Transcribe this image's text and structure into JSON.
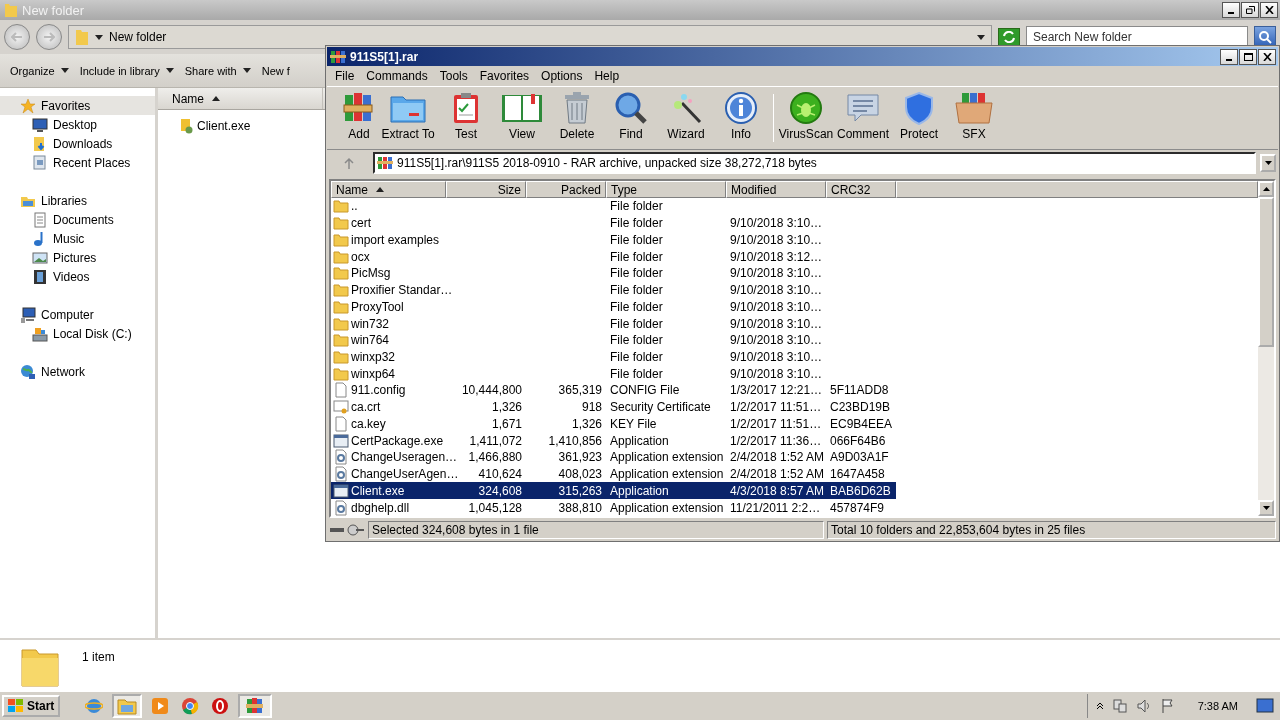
{
  "explorer": {
    "title": "New folder",
    "breadcrumb": "New folder",
    "search": {
      "placeholder": "Search New folder"
    },
    "commands": [
      {
        "label": "Organize",
        "menu": true
      },
      {
        "label": "Include in library",
        "menu": true
      },
      {
        "label": "Share with",
        "menu": true
      },
      {
        "label": "New f",
        "menu": false
      }
    ],
    "nav": [
      {
        "label": "Favorites",
        "selected": true,
        "children": [
          {
            "label": "Desktop",
            "selected": false
          },
          {
            "label": "Downloads",
            "selected": false
          },
          {
            "label": "Recent Places",
            "selected": false
          }
        ]
      },
      {
        "label": "Libraries",
        "selected": false,
        "children": [
          {
            "label": "Documents",
            "selected": false
          },
          {
            "label": "Music",
            "selected": false
          },
          {
            "label": "Pictures",
            "selected": false
          },
          {
            "label": "Videos",
            "selected": false
          }
        ]
      },
      {
        "label": "Computer",
        "selected": false,
        "children": [
          {
            "label": "Local Disk (C:)",
            "selected": false
          }
        ]
      },
      {
        "label": "Network",
        "selected": false
      }
    ],
    "columns": [
      {
        "label": "Name",
        "sorted": true
      }
    ],
    "files": [
      {
        "name": "Client.exe"
      }
    ],
    "details": {
      "count": "1 item"
    }
  },
  "archiver": {
    "title": "911S5[1].rar",
    "menu": [
      "File",
      "Commands",
      "Tools",
      "Favorites",
      "Options",
      "Help"
    ],
    "toolbar": [
      {
        "buttons": [
          {
            "label": "Add"
          },
          {
            "label": "Extract To"
          },
          {
            "label": "Test"
          },
          {
            "label": "View"
          },
          {
            "label": "Delete"
          },
          {
            "label": "Find"
          },
          {
            "label": "Wizard"
          },
          {
            "label": "Info"
          }
        ]
      },
      {
        "buttons": [
          {
            "label": "VirusScan"
          },
          {
            "label": "Comment"
          },
          {
            "label": "Protect"
          },
          {
            "label": "SFX"
          }
        ]
      }
    ],
    "path": "911S5[1].rar\\911S5 2018-0910 - RAR archive, unpacked size 38,272,718 bytes",
    "columns": [
      {
        "label": "Name",
        "sorted": true
      },
      {
        "label": "Size",
        "sorted": false
      },
      {
        "label": "Packed",
        "sorted": false
      },
      {
        "label": "Type",
        "sorted": false
      },
      {
        "label": "Modified",
        "sorted": false
      },
      {
        "label": "CRC32",
        "sorted": false
      }
    ],
    "rows": [
      {
        "kind": "folder",
        "name": "..",
        "size": "",
        "packed": "",
        "type": "File folder",
        "modified": "",
        "crc": "",
        "selected": false
      },
      {
        "kind": "folder",
        "name": "cert",
        "type": "File folder",
        "modified": "9/10/2018 3:10…",
        "selected": false
      },
      {
        "kind": "folder",
        "name": "import examples",
        "type": "File folder",
        "modified": "9/10/2018 3:10…",
        "selected": false
      },
      {
        "kind": "folder",
        "name": "ocx",
        "type": "File folder",
        "modified": "9/10/2018 3:12…",
        "selected": false
      },
      {
        "kind": "folder",
        "name": "PicMsg",
        "type": "File folder",
        "modified": "9/10/2018 3:10…",
        "selected": false
      },
      {
        "kind": "folder",
        "name": "Proxifier Standar…",
        "type": "File folder",
        "modified": "9/10/2018 3:10…",
        "selected": false
      },
      {
        "kind": "folder",
        "name": "ProxyTool",
        "type": "File folder",
        "modified": "9/10/2018 3:10…",
        "selected": false
      },
      {
        "kind": "folder",
        "name": "win732",
        "type": "File folder",
        "modified": "9/10/2018 3:10…",
        "selected": false
      },
      {
        "kind": "folder",
        "name": "win764",
        "type": "File folder",
        "modified": "9/10/2018 3:10…",
        "selected": false
      },
      {
        "kind": "folder",
        "name": "winxp32",
        "type": "File folder",
        "modified": "9/10/2018 3:10…",
        "selected": false
      },
      {
        "kind": "folder",
        "name": "winxp64",
        "type": "File folder",
        "modified": "9/10/2018 3:10…",
        "selected": false
      },
      {
        "kind": "file",
        "name": "911.config",
        "size": "10,444,800",
        "packed": "365,319",
        "type": "CONFIG File",
        "modified": "1/3/2017 12:21…",
        "crc": "5F11ADD8",
        "selected": false
      },
      {
        "kind": "certificate",
        "name": "ca.crt",
        "size": "1,326",
        "packed": "918",
        "type": "Security Certificate",
        "modified": "1/2/2017 11:51…",
        "crc": "C23BD19B",
        "selected": false
      },
      {
        "kind": "file",
        "name": "ca.key",
        "size": "1,671",
        "packed": "1,326",
        "type": "KEY File",
        "modified": "1/2/2017 11:51…",
        "crc": "EC9B4EEA",
        "selected": false
      },
      {
        "kind": "application",
        "name": "CertPackage.exe",
        "size": "1,411,072",
        "packed": "1,410,856",
        "type": "Application",
        "modified": "1/2/2017 11:36…",
        "crc": "066F64B6",
        "selected": false
      },
      {
        "kind": "extension",
        "name": "ChangeUseragen…",
        "size": "1,466,880",
        "packed": "361,923",
        "type": "Application extension",
        "modified": "2/4/2018 1:52 AM",
        "crc": "A9D03A1F",
        "selected": false
      },
      {
        "kind": "extension",
        "name": "ChangeUserAgen…",
        "size": "410,624",
        "packed": "408,023",
        "type": "Application extension",
        "modified": "2/4/2018 1:52 AM",
        "crc": "1647A458",
        "selected": false
      },
      {
        "kind": "application",
        "name": "Client.exe",
        "size": "324,608",
        "packed": "315,263",
        "type": "Application",
        "modified": "4/3/2018 8:57 AM",
        "crc": "BAB6D62B",
        "selected": true
      },
      {
        "kind": "extension",
        "name": "dbghelp.dll",
        "size": "1,045,128",
        "packed": "388,810",
        "type": "Application extension",
        "modified": "11/21/2011 2:2…",
        "crc": "457874F9",
        "selected": false
      }
    ],
    "status": {
      "selection": "Selected 324,608 bytes in 1 file",
      "total": "Total 10 folders and 22,853,604 bytes in 25 files"
    }
  },
  "taskbar": {
    "start": "Start",
    "apps": [
      {
        "active": false
      },
      {
        "active": true
      },
      {
        "active": false
      },
      {
        "active": false
      },
      {
        "active": false
      },
      {
        "active": true
      }
    ],
    "clock": "7:38 AM"
  }
}
